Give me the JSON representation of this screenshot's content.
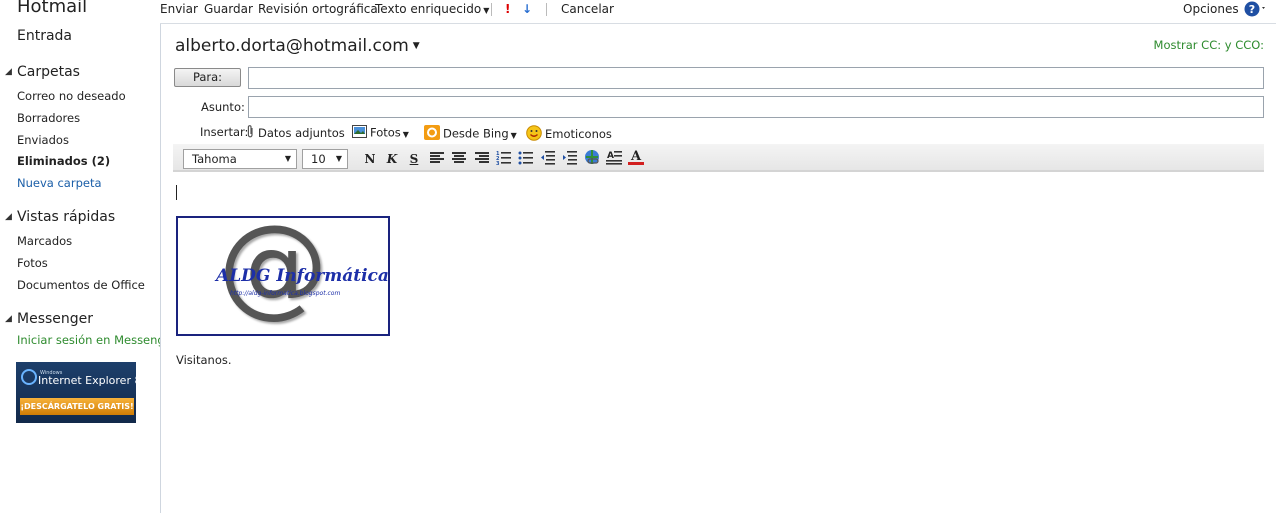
{
  "sidebar": {
    "brand": "Hotmail",
    "inbox": "Entrada",
    "folders_header": "Carpetas",
    "folders": [
      "Correo no deseado",
      "Borradores",
      "Enviados",
      "Eliminados (2)"
    ],
    "new_folder": "Nueva carpeta",
    "quick_views_header": "Vistas rápidas",
    "quick_views": [
      "Marcados",
      "Fotos",
      "Documentos de Office"
    ],
    "messenger_header": "Messenger",
    "messenger_login": "Iniciar sesión en Messenger",
    "ad": {
      "small": "Windows",
      "product": "Internet Explorer 8",
      "button": "¡DESCÁRGATELO GRATIS!"
    }
  },
  "toolbar": {
    "send": "Enviar",
    "save": "Guardar",
    "spellcheck": "Revisión ortográfica",
    "rich_text": "Texto enriquecido",
    "cancel": "Cancelar",
    "options": "Opciones"
  },
  "compose": {
    "from": "alberto.dorta@hotmail.com",
    "show_cc": "Mostrar CC: y CCO:",
    "to_button": "Para:",
    "to_value": "",
    "subject_label": "Asunto:",
    "subject_value": "",
    "insert_label": "Insertar:",
    "insert_items": [
      "Datos adjuntos",
      "Fotos",
      "Desde Bing",
      "Emoticonos"
    ],
    "font": "Tahoma",
    "size": "10",
    "format": {
      "bold": "N",
      "italic": "K",
      "underline": "S"
    },
    "logo": {
      "title": "ALDG Informática",
      "url": "http://aldg-informatica.blogspot.com"
    },
    "body_text": "Visitanos."
  },
  "colors": {
    "link": "#1a5ea8",
    "green": "#2e8b2e",
    "logo_blue": "#1d2fa8"
  }
}
